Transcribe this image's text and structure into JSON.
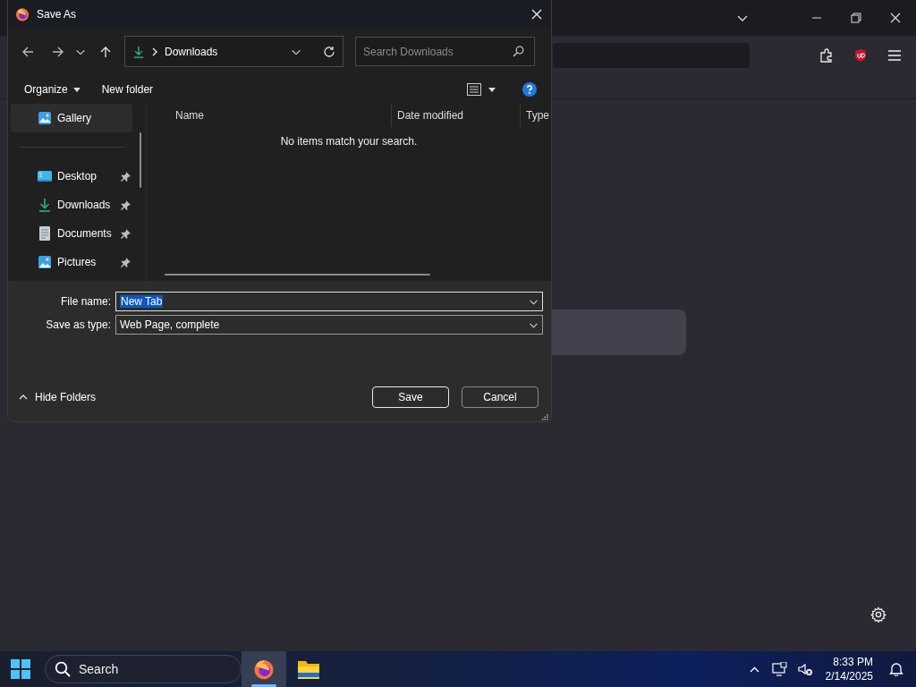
{
  "dialog": {
    "title": "Save As",
    "address": {
      "location": "Downloads"
    },
    "search": {
      "placeholder": "Search Downloads"
    },
    "commands": [
      "Organize",
      "New folder"
    ],
    "sidebar": {
      "items": [
        {
          "label": "Gallery",
          "kind": "gallery",
          "selected": true,
          "pinned": false
        },
        {
          "label": "Desktop",
          "kind": "desktop",
          "selected": false,
          "pinned": true
        },
        {
          "label": "Downloads",
          "kind": "downloads",
          "selected": false,
          "pinned": true
        },
        {
          "label": "Documents",
          "kind": "documents",
          "selected": false,
          "pinned": true
        },
        {
          "label": "Pictures",
          "kind": "pictures",
          "selected": false,
          "pinned": true
        }
      ]
    },
    "columns": [
      "Name",
      "Date modified",
      "Type"
    ],
    "empty_message": "No items match your search.",
    "file_name": {
      "label": "File name:",
      "value": "New Tab",
      "text_selected": true
    },
    "save_as_type": {
      "label": "Save as type:",
      "value": "Web Page, complete"
    },
    "hide_folders": "Hide Folders",
    "buttons": [
      {
        "label": "Save",
        "kind": "default"
      },
      {
        "label": "Cancel",
        "kind": "normal"
      }
    ]
  },
  "taskbar": {
    "search": {
      "placeholder": "Search"
    },
    "apps": [
      {
        "kind": "firefox",
        "active": true
      },
      {
        "kind": "files",
        "active": false
      }
    ],
    "time": "8:33 PM",
    "date": "2/14/2025"
  }
}
